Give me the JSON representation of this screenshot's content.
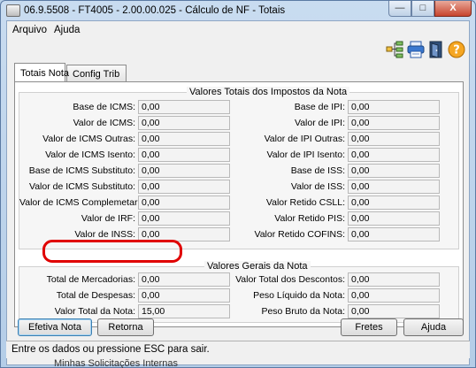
{
  "window": {
    "title": "06.9.5508 - FT4005 - 2.00.00.025 - Cálculo de NF - Totais",
    "minimize": "—",
    "maximize": "□",
    "close": "X"
  },
  "menu": [
    "Arquivo",
    "Ajuda"
  ],
  "toolbar_icons": [
    "tree-icon",
    "print-icon",
    "exit-door-icon",
    "help-icon"
  ],
  "tabs": [
    "Totais Nota",
    "Config Trib"
  ],
  "taxes_group": {
    "title": "Valores Totais dos Impostos da Nota",
    "left": [
      {
        "label": "Base de ICMS:",
        "value": "0,00"
      },
      {
        "label": "Valor de ICMS:",
        "value": "0,00"
      },
      {
        "label": "Valor de ICMS Outras:",
        "value": "0,00"
      },
      {
        "label": "Valor de ICMS Isento:",
        "value": "0,00"
      },
      {
        "label": "Base de ICMS Substituto:",
        "value": "0,00"
      },
      {
        "label": "Valor de ICMS Substituto:",
        "value": "0,00"
      },
      {
        "label": "Valor de ICMS Complemetar:",
        "value": "0,00"
      },
      {
        "label": "Valor de IRF:",
        "value": "0,00"
      },
      {
        "label": "Valor de INSS:",
        "value": "0,00"
      }
    ],
    "right": [
      {
        "label": "Base de IPI:",
        "value": "0,00"
      },
      {
        "label": "Valor de IPI:",
        "value": "0,00"
      },
      {
        "label": "Valor de IPI Outras:",
        "value": "0,00"
      },
      {
        "label": "Valor de IPI Isento:",
        "value": "0,00"
      },
      {
        "label": "Base de ISS:",
        "value": "0,00"
      },
      {
        "label": "Valor de ISS:",
        "value": "0,00"
      },
      {
        "label": "Valor Retido CSLL:",
        "value": "0,00"
      },
      {
        "label": "Valor Retido PIS:",
        "value": "0,00"
      },
      {
        "label": "Valor Retido COFINS:",
        "value": "0,00"
      }
    ]
  },
  "general_group": {
    "title": "Valores Gerais da Nota",
    "left": [
      {
        "label": "Total de Mercadorias:",
        "value": "0,00"
      },
      {
        "label": "Total de Despesas:",
        "value": "0,00"
      },
      {
        "label": "Valor Total da Nota:",
        "value": "15,00"
      }
    ],
    "right": [
      {
        "label": "Valor Total dos Descontos:",
        "value": "0,00"
      },
      {
        "label": "Peso Líquido da Nota:",
        "value": "0,00"
      },
      {
        "label": "Peso Bruto da Nota:",
        "value": "0,00"
      }
    ]
  },
  "buttons": {
    "efetiva": "Efetiva Nota",
    "retorna": "Retorna",
    "fretes": "Fretes",
    "ajuda": "Ajuda"
  },
  "status": "Entre os dados ou pressione ESC para sair.",
  "behind_text": "Minhas Solicitações Internas",
  "colors": {
    "highlight": "#e00000",
    "titlebar": "#b9d1ea"
  }
}
